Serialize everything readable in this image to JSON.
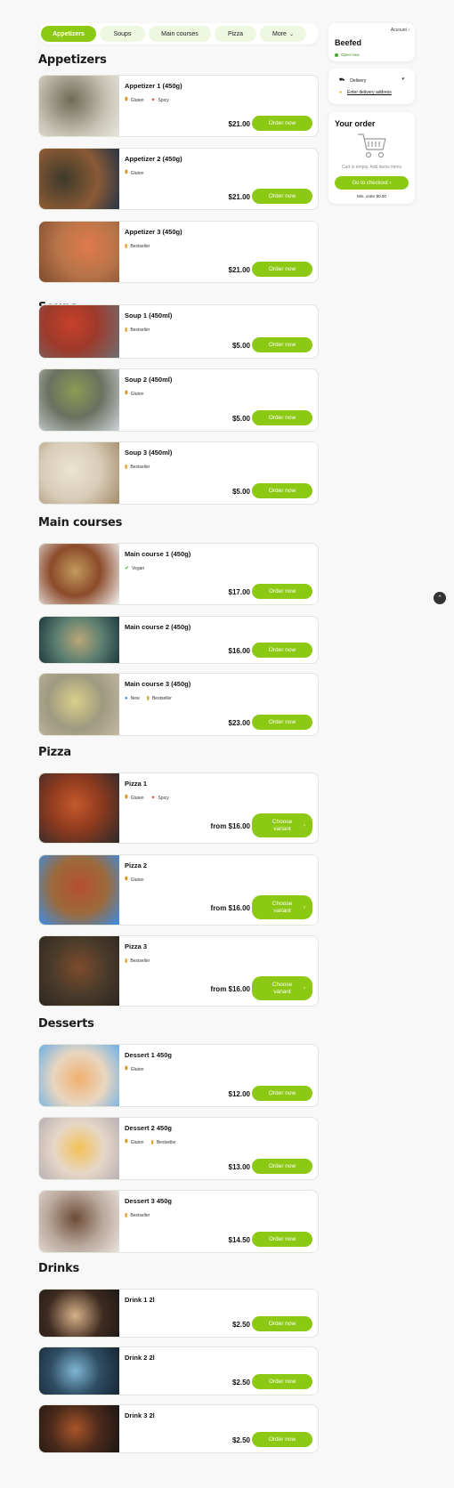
{
  "tabs": [
    {
      "label": "Appetizers",
      "active": true
    },
    {
      "label": "Soups",
      "active": false
    },
    {
      "label": "Main courses",
      "active": false
    },
    {
      "label": "Pizza",
      "active": false
    },
    {
      "label": "More",
      "active": false
    }
  ],
  "sections": [
    {
      "title": "Appetizers",
      "items": [
        {
          "name": "Appetizer 1 (450g)",
          "tags": [
            "Gluten",
            "Spicy"
          ],
          "price": "$21.00",
          "button": "Order now"
        },
        {
          "name": "Appetizer 2 (450g)",
          "tags": [
            "Gluten"
          ],
          "price": "$21.00",
          "button": "Order now"
        },
        {
          "name": "Appetizer 3 (450g)",
          "tags": [
            "Bestseller"
          ],
          "price": "$21.00",
          "button": "Order now"
        }
      ]
    },
    {
      "title": "Soups",
      "items": [
        {
          "name": "Soup 1 (450ml)",
          "tags": [
            "Bestseller"
          ],
          "price": "$5.00",
          "button": "Order now"
        },
        {
          "name": "Soup 2 (450ml)",
          "tags": [
            "Gluten"
          ],
          "price": "$5.00",
          "button": "Order now"
        },
        {
          "name": "Soup 3 (450ml)",
          "tags": [
            "Bestseller"
          ],
          "price": "$5.00",
          "button": "Order now"
        }
      ]
    },
    {
      "title": "Main courses",
      "items": [
        {
          "name": "Main course 1 (450g)",
          "tags": [
            "Vegan"
          ],
          "price": "$17.00",
          "button": "Order now"
        },
        {
          "name": "Main course 2 (450g)",
          "tags": [],
          "price": "$16.00",
          "button": "Order now"
        },
        {
          "name": "Main course 3 (450g)",
          "tags": [
            "New",
            "Bestseller"
          ],
          "price": "$23.00",
          "button": "Order now"
        }
      ]
    },
    {
      "title": "Pizza",
      "items": [
        {
          "name": "Pizza 1",
          "tags": [
            "Gluten",
            "Spicy"
          ],
          "price": "from $16.00",
          "button": "Choose variant"
        },
        {
          "name": "Pizza 2",
          "tags": [
            "Gluten"
          ],
          "price": "from $16.00",
          "button": "Choose variant"
        },
        {
          "name": "Pizza 3",
          "tags": [
            "Bestseller"
          ],
          "price": "from $16.00",
          "button": "Choose variant"
        }
      ]
    },
    {
      "title": "Desserts",
      "items": [
        {
          "name": "Dessert 1 450g",
          "tags": [
            "Gluten"
          ],
          "price": "$12.00",
          "button": "Order now"
        },
        {
          "name": "Dessert 2 450g",
          "tags": [
            "Gluten",
            "Bestseller"
          ],
          "price": "$13.00",
          "button": "Order now"
        },
        {
          "name": "Dessert 3 450g",
          "tags": [
            "Bestseller"
          ],
          "price": "$14.50",
          "button": "Order now"
        }
      ]
    },
    {
      "title": "Drinks",
      "items": [
        {
          "name": "Drink 1 2l",
          "tags": [],
          "price": "$2.50",
          "button": "Order now"
        },
        {
          "name": "Drink 2 2l",
          "tags": [],
          "price": "$2.50",
          "button": "Order now"
        },
        {
          "name": "Drink 3 2l",
          "tags": [],
          "price": "$2.50",
          "button": "Order now"
        }
      ]
    }
  ],
  "restaurant": {
    "account": "Account",
    "name": "Beefed",
    "status": "Open now"
  },
  "delivery": {
    "mode": "Delivery",
    "address": "Enter delivery address"
  },
  "order": {
    "title": "Your order",
    "empty": "Cart is empty. Add items items",
    "checkout": "Go to checkout",
    "min_order": "Min. order $0.00"
  },
  "colors": {
    "accent": "#8cc914",
    "tab_bg": "#eef7df",
    "open": "#3cb227"
  }
}
